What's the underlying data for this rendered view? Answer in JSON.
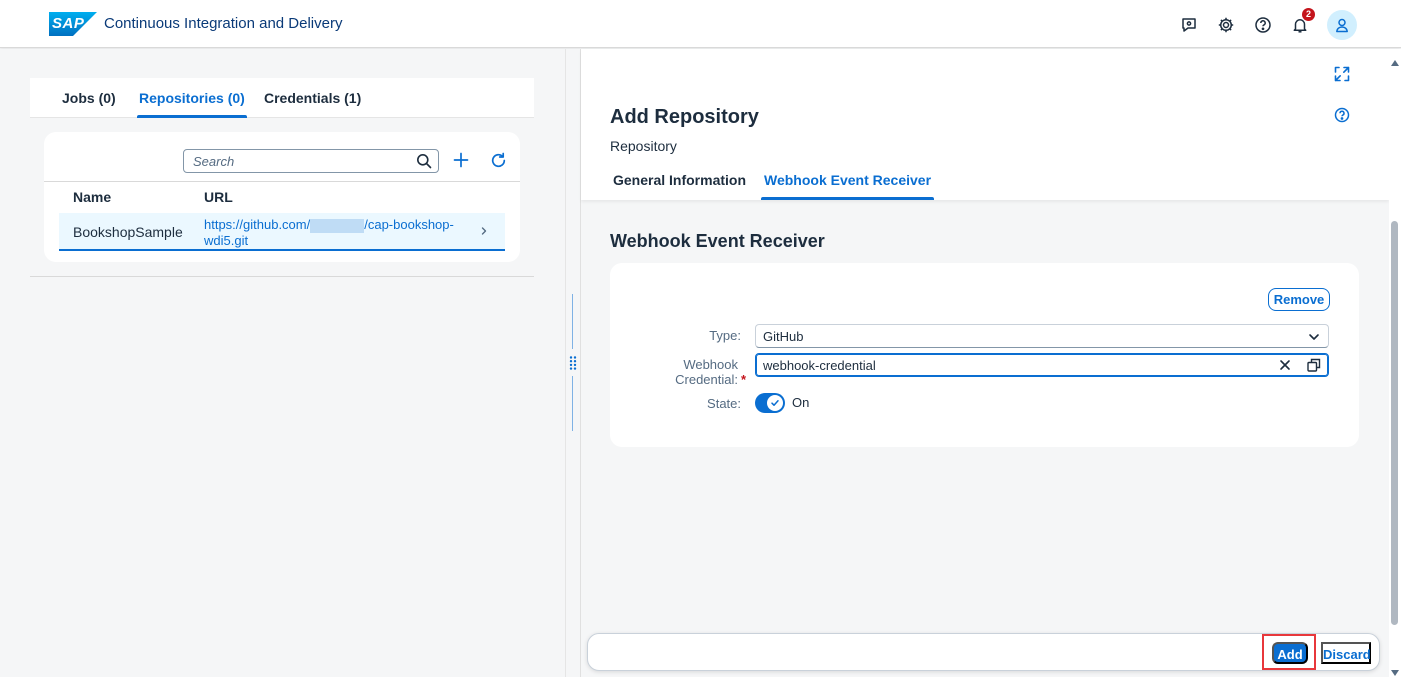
{
  "shell": {
    "logo_text": "SAP",
    "app_title": "Continuous Integration and Delivery",
    "notification_count": "2",
    "icons": [
      "feedback-icon",
      "settings-icon",
      "help-icon",
      "notifications-icon",
      "user-icon"
    ]
  },
  "left": {
    "tabs": [
      {
        "label": "Jobs (0)",
        "active": false
      },
      {
        "label": "Repositories (0)",
        "active": true
      },
      {
        "label": "Credentials (1)",
        "active": false
      }
    ],
    "search_placeholder": "Search",
    "columns": [
      "Name",
      "URL"
    ],
    "rows": [
      {
        "name": "BookshopSample",
        "url_before": "https://github.com/",
        "url_after": "/cap-bookshop-wdi5.git"
      }
    ]
  },
  "detail": {
    "title": "Add Repository",
    "subtitle": "Repository",
    "tabs": [
      {
        "label": "General Information",
        "active": false
      },
      {
        "label": "Webhook Event Receiver",
        "active": true
      }
    ],
    "section_title": "Webhook Event Receiver",
    "remove_label": "Remove",
    "type_label": "Type:",
    "type_value": "GitHub",
    "credential_label_line1": "Webhook",
    "credential_label_line2": "Credential:",
    "credential_required_mark": "*",
    "credential_value": "webhook-credential",
    "state_label": "State:",
    "state_value": "On"
  },
  "footer": {
    "add_label": "Add",
    "discard_label": "Discard"
  },
  "colors": {
    "accent": "#0a6ed1",
    "highlight_frame": "#e8373b",
    "badge": "#c4141c"
  }
}
